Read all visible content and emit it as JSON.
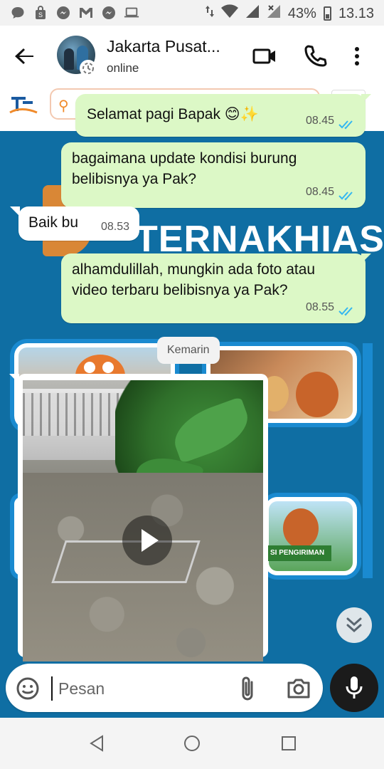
{
  "status_bar": {
    "battery": "43%",
    "time": "13.13",
    "left_icons": [
      "chat-bubble-icon",
      "shopping-bag-icon",
      "messenger-icon",
      "gmail-icon",
      "messenger-icon",
      "laptop-icon"
    ],
    "right_icons": [
      "data-arrows-icon",
      "wifi-icon",
      "signal-icon",
      "signal-x-icon",
      "battery-icon"
    ]
  },
  "header": {
    "contact_name": "Jakarta Pusat...",
    "status": "online",
    "icons": [
      "back-arrow-icon",
      "video-call-icon",
      "phone-call-icon",
      "more-options-icon"
    ]
  },
  "wallpaper": {
    "title_text": "TERNAKHIAS",
    "banner_text": "SI PENGIRIMAN"
  },
  "messages": [
    {
      "direction": "out",
      "text": "Selamat pagi Bapak 😊✨",
      "time": "08.45",
      "read": true
    },
    {
      "direction": "out",
      "text": "bagaimana update kondisi burung belibisnya ya Pak?",
      "time": "08.45",
      "read": true
    },
    {
      "direction": "in",
      "text": "Baik bu",
      "time": "08.53"
    },
    {
      "direction": "out",
      "text": "alhamdulillah, mungkin ada foto atau video terbaru belibisnya ya Pak?",
      "time": "08.55",
      "read": true
    }
  ],
  "date_separator": "Kemarin",
  "video_message": {
    "type": "video",
    "icon": "play-icon"
  },
  "composer": {
    "placeholder": "Pesan",
    "value": "",
    "icons": [
      "emoji-icon",
      "attach-icon",
      "camera-icon",
      "mic-icon"
    ]
  },
  "theme": {
    "outgoing_bubble": "#dcf8c6",
    "incoming_bubble": "#ffffff",
    "read_ticks": "#34b7f1",
    "wallpaper_blue": "#0f6ea3"
  },
  "nav": {
    "icons": [
      "nav-back-icon",
      "nav-home-icon",
      "nav-recents-icon"
    ]
  }
}
